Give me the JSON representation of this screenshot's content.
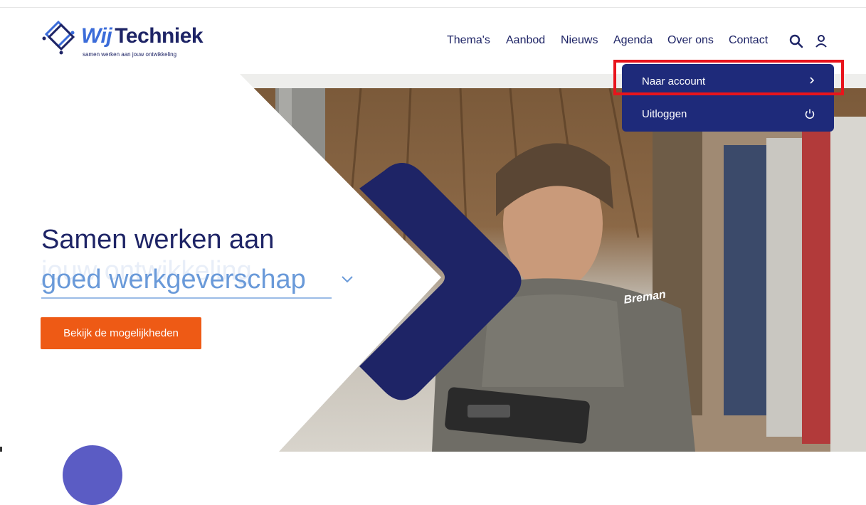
{
  "brand": {
    "name_part1": "Wij",
    "name_part2": "Techniek",
    "tagline": "samen werken aan jouw ontwikkeling"
  },
  "nav": {
    "items": [
      "Thema's",
      "Aanbod",
      "Nieuws",
      "Agenda",
      "Over ons",
      "Contact"
    ],
    "icons": [
      "search-icon",
      "user-icon"
    ]
  },
  "account_menu": {
    "items": [
      {
        "label": "Naar account",
        "icon": "chevron-right-icon"
      },
      {
        "label": "Uitloggen",
        "icon": "power-icon"
      }
    ]
  },
  "hero": {
    "headline": "Samen werken aan",
    "rotating_text": "goed werkgeverschap",
    "rotating_ghost": "jouw ontwikkeling",
    "cta_label": "Bekijk de mogelijkheden",
    "shirt_logo": "Breman"
  },
  "colors": {
    "navy": "#1e2466",
    "brand_blue": "#3b6cd9",
    "accent_orange": "#ee5a15",
    "light_blue_text": "#6a9ad9",
    "highlight_red": "#e8141c"
  }
}
